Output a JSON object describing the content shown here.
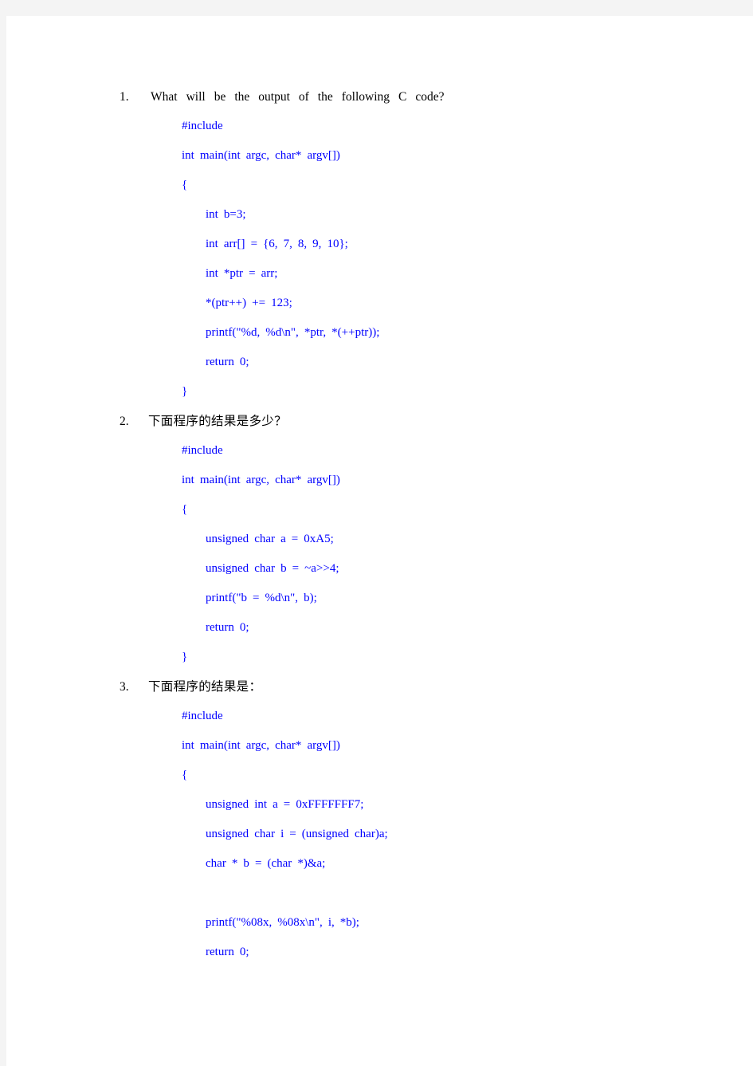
{
  "document": {
    "page_background": "#ffffff",
    "canvas_background": "#f4f4f4",
    "code_color": "#0000ff",
    "text_color": "#000000",
    "questions": [
      {
        "number": "1.",
        "prompt": "What will be the output of the following C code?",
        "code": [
          {
            "indent": 1,
            "text": "#include"
          },
          {
            "indent": 1,
            "text": "int main(int argc, char* argv[])"
          },
          {
            "indent": 1,
            "text": "{"
          },
          {
            "indent": 2,
            "text": "int b=3;"
          },
          {
            "indent": 2,
            "text": "int arr[] = {6, 7, 8, 9, 10};"
          },
          {
            "indent": 2,
            "text": "int *ptr = arr;"
          },
          {
            "indent": 2,
            "text": "*(ptr++) += 123;"
          },
          {
            "indent": 2,
            "text": "printf(\"%d, %d\\n\", *ptr, *(++ptr));"
          },
          {
            "indent": 2,
            "text": "return 0;"
          },
          {
            "indent": 1,
            "text": "}"
          }
        ]
      },
      {
        "number": "2.",
        "prompt": "下面程序的结果是多少？",
        "code": [
          {
            "indent": 1,
            "text": "#include"
          },
          {
            "indent": 1,
            "text": "int main(int argc, char* argv[])"
          },
          {
            "indent": 1,
            "text": "{"
          },
          {
            "indent": 2,
            "text": "unsigned char a = 0xA5;"
          },
          {
            "indent": 2,
            "text": "unsigned char b = ~a>>4;"
          },
          {
            "indent": 2,
            "text": "printf(\"b = %d\\n\", b);"
          },
          {
            "indent": 2,
            "text": "return 0;"
          },
          {
            "indent": 1,
            "text": "}"
          }
        ]
      },
      {
        "number": "3.",
        "prompt": "下面程序的结果是：",
        "code": [
          {
            "indent": 1,
            "text": "#include"
          },
          {
            "indent": 1,
            "text": "int main(int argc, char* argv[])"
          },
          {
            "indent": 1,
            "text": "{"
          },
          {
            "indent": 2,
            "text": "unsigned int a = 0xFFFFFFF7;"
          },
          {
            "indent": 2,
            "text": "unsigned char i = (unsigned char)a;"
          },
          {
            "indent": 2,
            "text": "char * b = (char *)&a;"
          },
          {
            "indent": 2,
            "text": ""
          },
          {
            "indent": 2,
            "text": "printf(\"%08x, %08x\\n\", i, *b);"
          },
          {
            "indent": 2,
            "text": "return 0;"
          }
        ]
      }
    ]
  }
}
